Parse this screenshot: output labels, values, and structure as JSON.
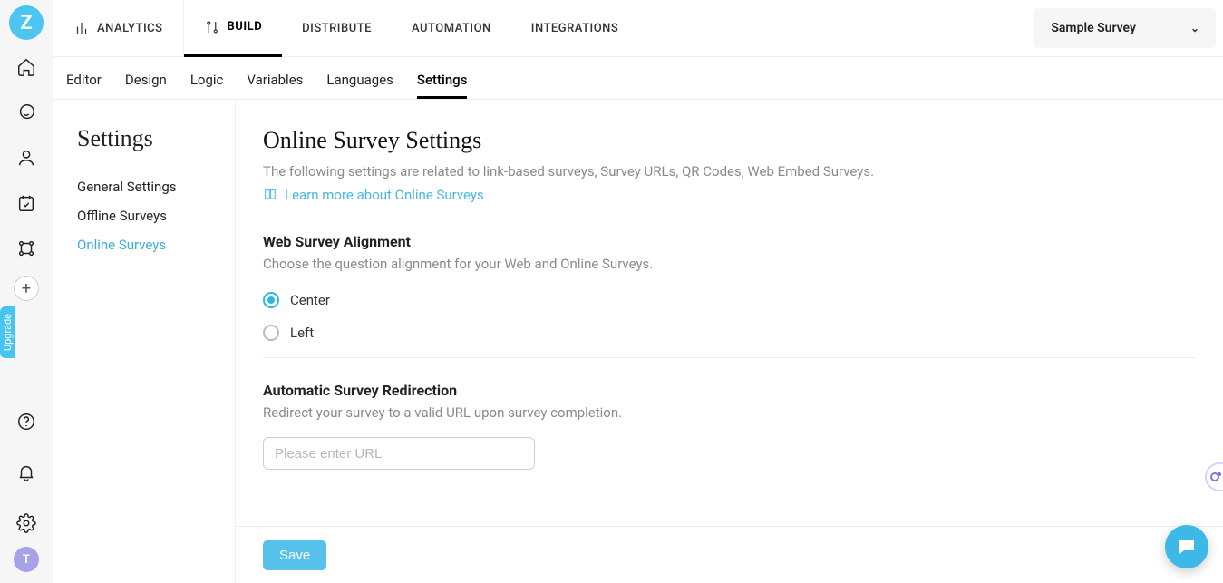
{
  "logo_letter": "Z",
  "upgrade_label": "Upgrade",
  "avatar_letter": "T",
  "topnav": {
    "analytics": "ANALYTICS",
    "build": "BUILD",
    "distribute": "DISTRIBUTE",
    "automation": "AUTOMATION",
    "integrations": "INTEGRATIONS"
  },
  "survey_dropdown": "Sample Survey",
  "subtabs": {
    "editor": "Editor",
    "design": "Design",
    "logic": "Logic",
    "variables": "Variables",
    "languages": "Languages",
    "settings": "Settings"
  },
  "settings_side": {
    "heading": "Settings",
    "items": {
      "general": "General Settings",
      "offline": "Offline Surveys",
      "online": "Online Surveys"
    }
  },
  "main": {
    "title": "Online Survey Settings",
    "subtitle": "The following settings are related to link-based surveys, Survey URLs, QR Codes, Web Embed Surveys.",
    "learn_link": "Learn more about Online Surveys",
    "align_title": "Web Survey Alignment",
    "align_desc": "Choose the question alignment for your Web and Online Surveys.",
    "align_options": {
      "center": "Center",
      "left": "Left"
    },
    "align_selected": "center",
    "redirect_title": "Automatic Survey Redirection",
    "redirect_desc": "Redirect your survey to a valid URL upon survey completion.",
    "redirect_placeholder": "Please enter URL",
    "save": "Save"
  }
}
